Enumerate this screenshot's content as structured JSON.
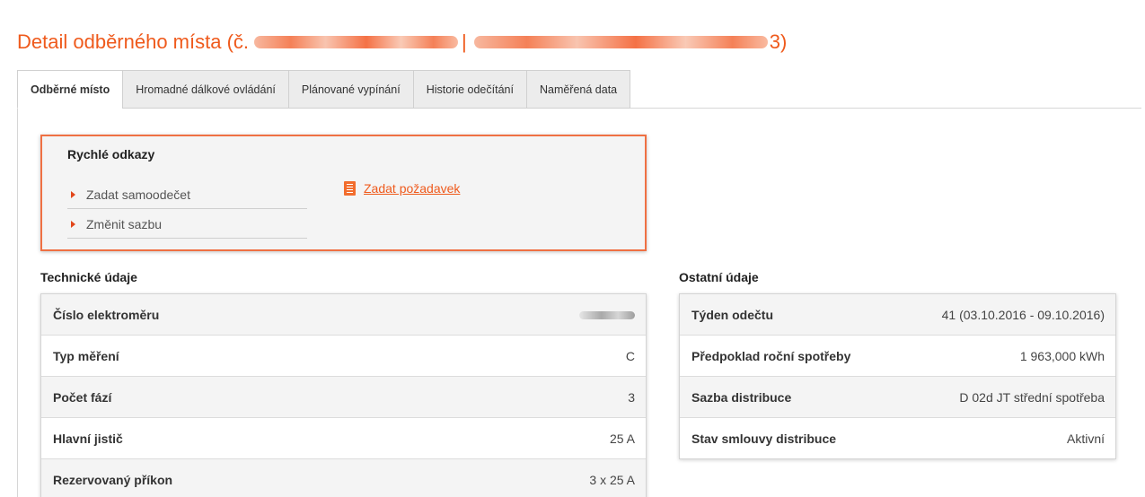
{
  "header": {
    "title_prefix": "Detail odběrného místa (č.",
    "title_separator": "|",
    "title_suffix": "3)"
  },
  "tabs": [
    {
      "label": "Odběrné místo",
      "active": true
    },
    {
      "label": "Hromadné dálkové ovládání",
      "active": false
    },
    {
      "label": "Plánované vypínání",
      "active": false
    },
    {
      "label": "Historie odečítání",
      "active": false
    },
    {
      "label": "Naměřená data",
      "active": false
    }
  ],
  "quick_links": {
    "title": "Rychlé odkazy",
    "items": [
      {
        "label": "Zadat samoodečet",
        "icon": "arrow-right-icon"
      },
      {
        "label": "Změnit sazbu",
        "icon": "arrow-right-icon"
      }
    ],
    "request_link": {
      "label": "Zadat požadavek",
      "icon": "document-list-icon"
    }
  },
  "technical": {
    "title": "Technické údaje",
    "rows": [
      {
        "label": "Číslo elektroměru",
        "value": ""
      },
      {
        "label": "Typ měření",
        "value": "C"
      },
      {
        "label": "Počet fází",
        "value": "3"
      },
      {
        "label": "Hlavní jistič",
        "value": "25 A"
      },
      {
        "label": "Rezervovaný příkon",
        "value": "3 x 25 A"
      }
    ]
  },
  "other": {
    "title": "Ostatní údaje",
    "rows": [
      {
        "label": "Týden odečtu",
        "value": "41 (03.10.2016 - 09.10.2016)"
      },
      {
        "label": "Předpoklad roční spotřeby",
        "value": "1 963,000 kWh"
      },
      {
        "label": "Sazba distribuce",
        "value": "D 02d JT střední spotřeba"
      },
      {
        "label": "Stav smlouvy distribuce",
        "value": "Aktivní"
      }
    ]
  },
  "colors": {
    "accent": "#ef5a1c",
    "quick_box_border": "#ef7043",
    "tab_inactive_bg": "#ececec"
  }
}
